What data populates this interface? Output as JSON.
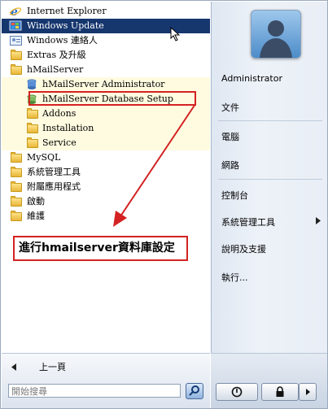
{
  "programs": [
    {
      "label": "Internet Explorer",
      "icon": "internet-explorer-icon"
    },
    {
      "label": "Windows Update",
      "icon": "windows-update-icon"
    },
    {
      "label": "Windows 連絡人",
      "icon": "contacts-icon"
    },
    {
      "label": "Extras 及升級",
      "icon": "folder-icon"
    },
    {
      "label": "hMailServer",
      "icon": "folder-icon"
    },
    {
      "label": "hMailServer Administrator",
      "icon": "hmailserver-admin-icon"
    },
    {
      "label": "hMailServer Database Setup",
      "icon": "database-setup-icon"
    },
    {
      "label": "Addons",
      "icon": "folder-icon"
    },
    {
      "label": "Installation",
      "icon": "folder-icon"
    },
    {
      "label": "Service",
      "icon": "folder-icon"
    },
    {
      "label": "MySQL",
      "icon": "folder-icon"
    },
    {
      "label": "系統管理工具",
      "icon": "folder-icon"
    },
    {
      "label": "附屬應用程式",
      "icon": "folder-icon"
    },
    {
      "label": "啟動",
      "icon": "folder-icon"
    },
    {
      "label": "維護",
      "icon": "folder-icon"
    }
  ],
  "back_label": "上一頁",
  "search_placeholder": "開始搜尋",
  "right_items": [
    "Administrator",
    "文件",
    "電腦",
    "網路",
    "控制台",
    "系統管理工具",
    "說明及支援",
    "執行..."
  ],
  "annotation": "進行hmailserver資料庫設定",
  "colors": {
    "selected": "#16366e",
    "annotation_red": "#d42222"
  }
}
